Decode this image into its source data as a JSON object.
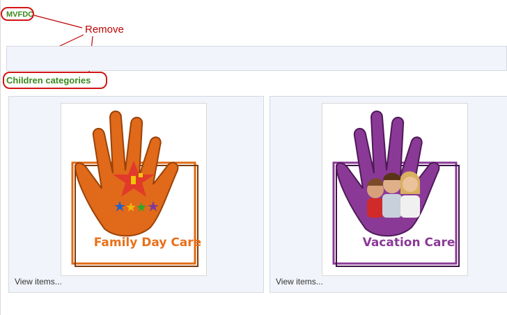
{
  "site": {
    "title": "MVFDC"
  },
  "annotation": {
    "remove_label": "Remove"
  },
  "section": {
    "heading": "Children categories"
  },
  "categories": [
    {
      "logo_caption": "Family Day Care",
      "link_label": "View items...",
      "color": "#e8701a",
      "icon": "hand-star-logo"
    },
    {
      "logo_caption": "Vacation Care",
      "link_label": "View items...",
      "color": "#8a3a96",
      "icon": "hand-children-logo"
    }
  ],
  "colors": {
    "accent_green": "#3a8a1c",
    "annotation_red": "#d21414",
    "panel_bg": "#f2f4fb"
  }
}
